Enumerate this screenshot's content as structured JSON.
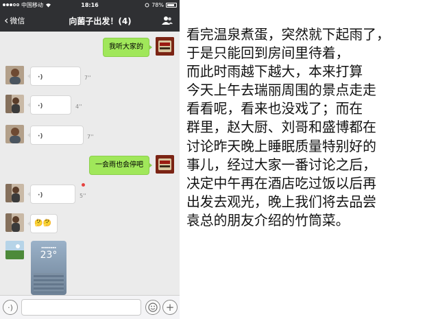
{
  "status_bar": {
    "carrier": "中国移动",
    "time": "18:16",
    "battery": "78%"
  },
  "nav": {
    "back_label": "微信",
    "title": "向菌子出发！(4)"
  },
  "messages": [
    {
      "side": "out",
      "type": "text",
      "text": "我听大家的"
    },
    {
      "side": "in",
      "type": "voice",
      "duration": "7''"
    },
    {
      "side": "in",
      "type": "voice",
      "duration": "4''"
    },
    {
      "side": "in",
      "type": "voice",
      "duration": "7''"
    },
    {
      "side": "out",
      "type": "text",
      "text": "一会雨也会停吧"
    },
    {
      "side": "in",
      "type": "voice",
      "duration": "5''",
      "unread": true
    },
    {
      "side": "in",
      "type": "emoji",
      "text": "🤔🤔"
    },
    {
      "side": "in",
      "type": "image",
      "temperature": "23°"
    }
  ],
  "input_bar": {
    "message_value": ""
  },
  "caption": {
    "lines": [
      "看完温泉煮蛋，突然就下起雨了，",
      "于是只能回到房间里待着，",
      "而此时雨越下越大，本来打算",
      "今天上午去瑞丽周围的景点走走",
      "看看呢，看来也没戏了；而在",
      "群里，赵大厨、刘哥和盛博都在",
      "讨论昨天晚上睡眠质量特别好的",
      "事儿，经过大家一番讨论之后，",
      "决定中午再在酒店吃过饭以后再",
      "出发去观光，晚上我们将去品尝",
      "袁总的朋友介绍的竹筒菜。"
    ]
  },
  "colors": {
    "navbar": "#2f3033",
    "chat_bg": "#ebebeb",
    "bubble_out": "#a0e75a",
    "bubble_in": "#ffffff",
    "unread": "#e64340"
  },
  "icons": [
    "back-chevron-icon",
    "group-info-icon",
    "voice-icon",
    "voice-mode-icon",
    "emoji-icon",
    "plus-icon",
    "wifi-icon",
    "battery-icon",
    "unread-dot-icon"
  ]
}
